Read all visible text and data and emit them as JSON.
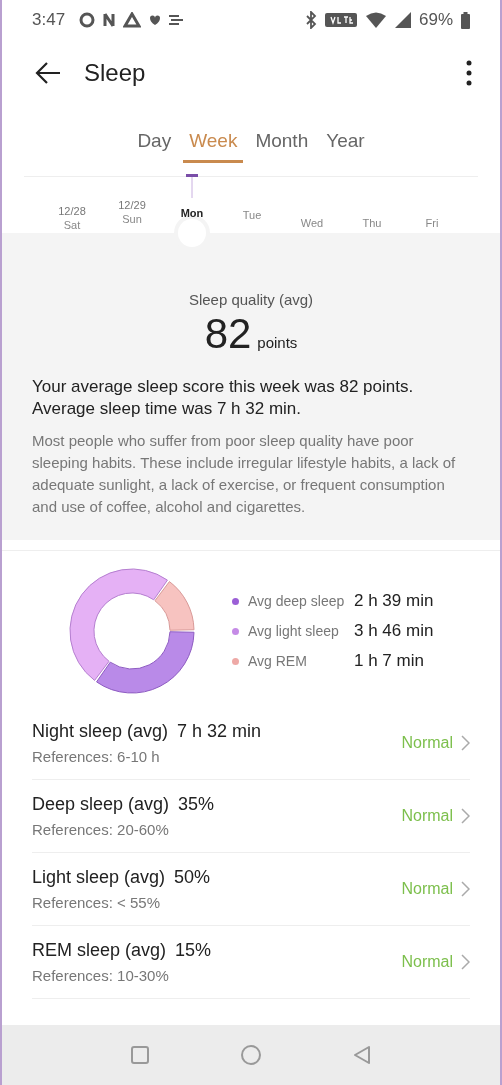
{
  "status_bar": {
    "time": "3:47",
    "battery": "69%"
  },
  "app_bar": {
    "title": "Sleep"
  },
  "tabs": [
    {
      "label": "Day",
      "selected": false
    },
    {
      "label": "Week",
      "selected": true
    },
    {
      "label": "Month",
      "selected": false
    },
    {
      "label": "Year",
      "selected": false
    }
  ],
  "days": [
    {
      "date": "12/28",
      "day": "Sat",
      "selected": false
    },
    {
      "date": "12/29",
      "day": "Sun",
      "selected": false
    },
    {
      "day": "Mon",
      "selected": true
    },
    {
      "day": "Tue",
      "selected": false
    },
    {
      "day": "Wed",
      "selected": false
    },
    {
      "day": "Thu",
      "selected": false
    },
    {
      "day": "Fri",
      "selected": false
    }
  ],
  "summary": {
    "label": "Sleep quality (avg)",
    "score": "82",
    "unit": "points",
    "headline": "Your average sleep score this week was 82 points. Average sleep time was 7 h 32 min.",
    "advice": "Most people who suffer from poor sleep quality have poor sleeping habits. These include irregular lifestyle habits, a lack of adequate sunlight, a lack of exercise, or frequent consumption and use of coffee, alcohol and cigarettes."
  },
  "breakdown": {
    "chart_data": {
      "type": "donut",
      "categories": [
        "Avg deep sleep",
        "Avg light sleep",
        "Avg REM"
      ],
      "series": [
        {
          "values": [
            35,
            50,
            15
          ]
        }
      ]
    },
    "legend": [
      {
        "value": "2 h 39 min",
        "color": "#9b5fd6"
      },
      {
        "value": "3 h 46 min",
        "color": "#c58be6"
      },
      {
        "value": "1 h 7 min",
        "color": "#eea9a6"
      }
    ]
  },
  "metrics": [
    {
      "name": "Night sleep (avg)",
      "value": "7 h 32 min",
      "reference": "References: 6-10 h",
      "status": "Normal"
    },
    {
      "name": "Deep sleep (avg)",
      "value": "35%",
      "reference": "References: 20-60%",
      "status": "Normal"
    },
    {
      "name": "Light sleep (avg)",
      "value": "50%",
      "reference": "References: < 55%",
      "status": "Normal"
    },
    {
      "name": "REM sleep (avg)",
      "value": "15%",
      "reference": "References: 10-30%",
      "status": "Normal"
    }
  ]
}
